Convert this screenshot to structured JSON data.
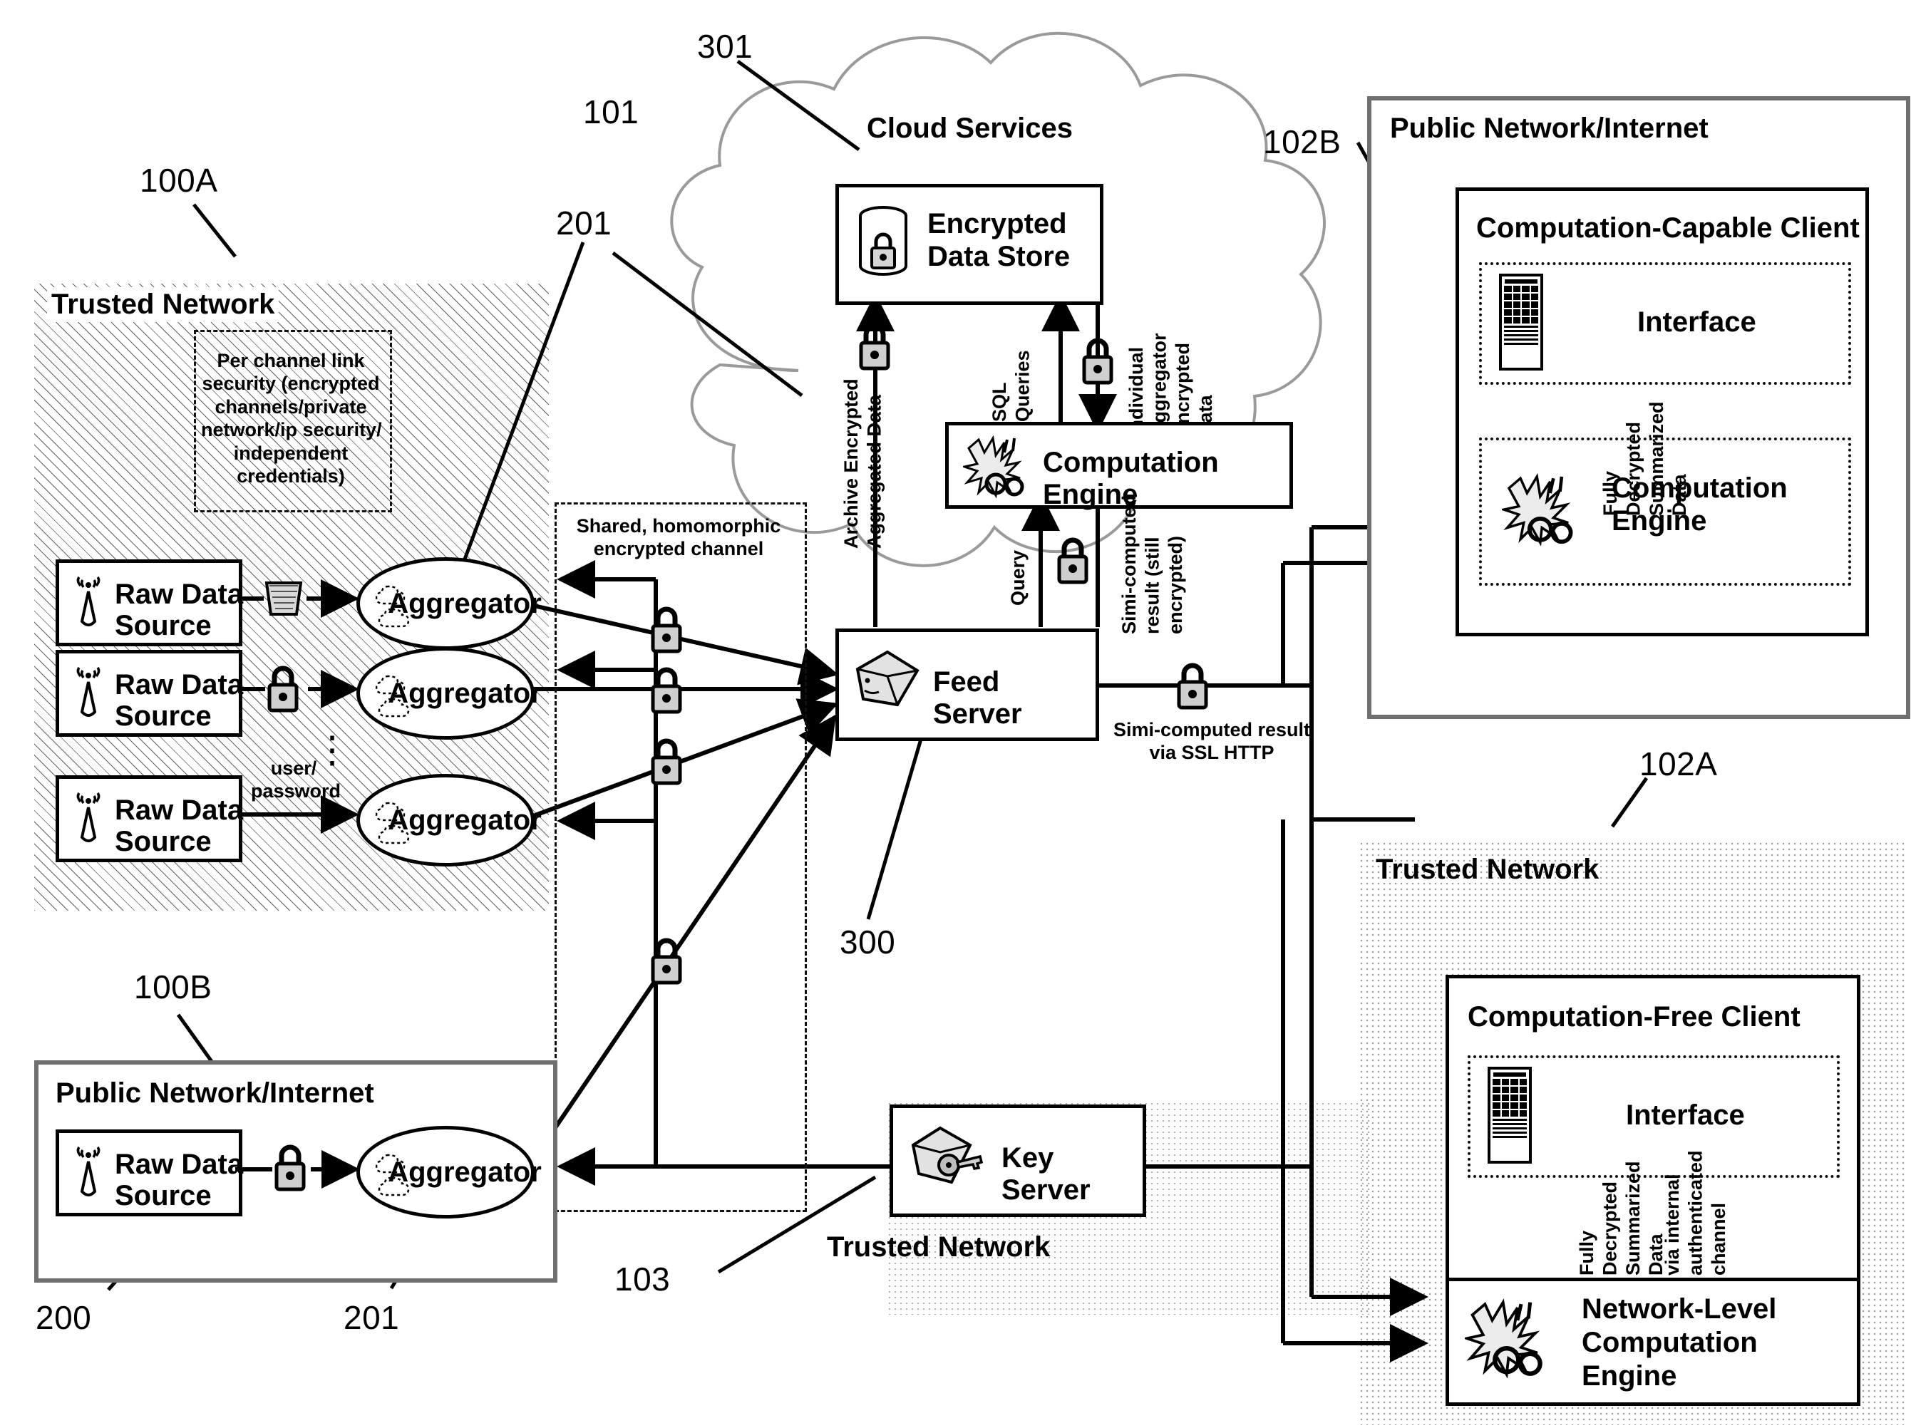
{
  "figure": {
    "type": "patent-network-diagram",
    "reference_numerals": {
      "n100A": "100A",
      "n100B": "100B",
      "n101": "101",
      "n102A": "102A",
      "n102B": "102B",
      "n103": "103",
      "n200": "200",
      "n201_top": "201",
      "n201_bottom": "201",
      "n300": "300",
      "n301": "301"
    }
  },
  "trusted_network_left": {
    "title": "Trusted Network",
    "callout": "Per channel link\nsecurity (encrypted\nchannels/private\nnetwork/ip security/\nindependent\ncredentials)",
    "sources": [
      {
        "label": "Raw Data\nSource",
        "link_icon": "shield-icon",
        "link_label": ""
      },
      {
        "label": "Raw Data\nSource",
        "link_icon": "padlock-icon",
        "link_label": ""
      },
      {
        "label": "Raw Data\nSource",
        "link_icon": "none",
        "link_label": "user/\npassword"
      }
    ],
    "aggregators": [
      {
        "label": "Aggregator"
      },
      {
        "label": "Aggregator"
      },
      {
        "label": "Aggregator"
      }
    ],
    "ellipsis": "⋮"
  },
  "shared_channel": {
    "label": "Shared, homomorphic\nencrypted channel",
    "locks": [
      "padlock-icon",
      "padlock-icon",
      "padlock-icon",
      "padlock-icon"
    ]
  },
  "cloud": {
    "title": "Cloud Services",
    "encrypted_data_store": {
      "label": "Encrypted\nData Store",
      "icon": "database-lock-icon"
    },
    "computation_engine": {
      "label": "Computation Engine",
      "icon": "gears-computation-icon"
    },
    "feed_server": {
      "label": "Feed Server",
      "icon": "server-cube-icon"
    },
    "edges": {
      "archive": "Archive Encrypted\nAggregated Data",
      "sql_queries": "SQL\nQueries",
      "individual_aggregator": "Individual\nAggregator\nEncrypted\nData",
      "query": "Query",
      "semi_computed": "Simi-computed\nresult (still\nencrypted)",
      "semi_computed_ssl": "Simi-computed result\nvia SSL HTTP"
    }
  },
  "public_network_right": {
    "title": "Public Network/Internet",
    "client": {
      "title": "Computation-Capable Client",
      "interface_label": "Interface",
      "interface_icon": "mobile-device-icon",
      "engine_label": "Computation\nEngine",
      "engine_icon": "gears-computation-icon",
      "edge_label": "Fully\nDecrypted\nSummarized\nData"
    }
  },
  "trusted_network_right": {
    "title": "Trusted Network",
    "client": {
      "title": "Computation-Free Client",
      "interface_label": "Interface",
      "interface_icon": "mobile-device-icon"
    },
    "edge_label_left": "Fully\nDecrypted\nSummarized\nData",
    "edge_label_right": "via internal\nauthenticated\nchannel",
    "network_engine": {
      "label": "Network-Level\nComputation\nEngine",
      "icon": "gears-computation-icon"
    }
  },
  "public_network_bottom_left": {
    "title": "Public Network/Internet",
    "source": {
      "label": "Raw Data\nSource",
      "icon": "tower-icon"
    },
    "link_icon": "padlock-icon",
    "aggregator": {
      "label": "Aggregator"
    }
  },
  "key_server": {
    "label": "Key Server",
    "icon": "key-server-icon",
    "network_title": "Trusted Network"
  }
}
